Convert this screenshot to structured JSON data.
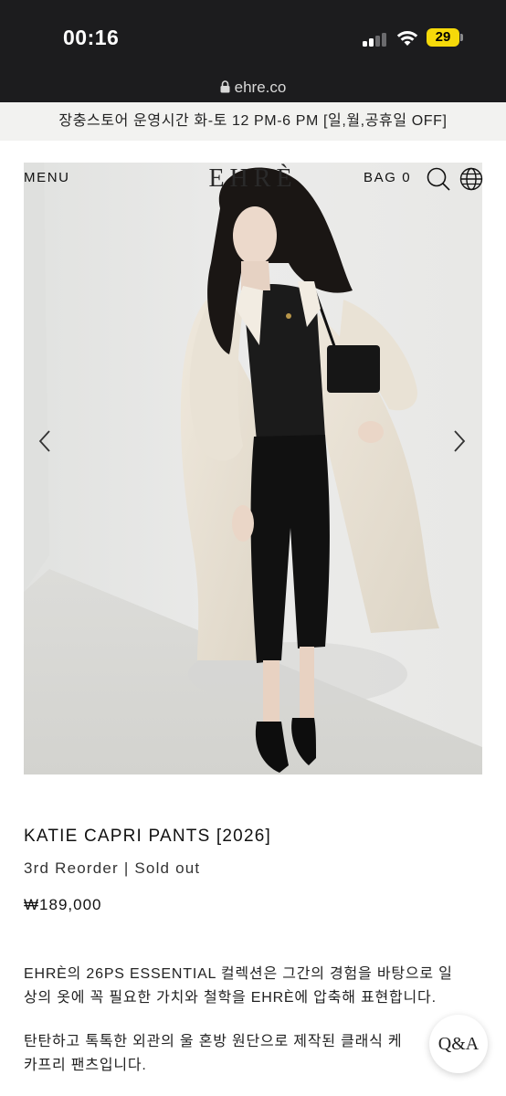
{
  "status_bar": {
    "time": "00:16",
    "battery_level": "29",
    "signal_icon": "cellular-signal-icon",
    "wifi_icon": "wifi-icon"
  },
  "browser": {
    "url": "ehre.co",
    "lock_icon": "lock-icon"
  },
  "notice": {
    "text": "장충스토어 운영시간 화-토 12 PM-6 PM [일,월,공휴일 OFF]"
  },
  "header": {
    "menu_label": "MENU",
    "logo": "EHRÈ",
    "bag_label": "BAG 0",
    "search_icon": "search-icon",
    "language_icon": "globe-icon"
  },
  "carousel": {
    "prev_icon": "chevron-left-icon",
    "next_icon": "chevron-right-icon"
  },
  "product": {
    "name": "KATIE CAPRI PANTS [2026]",
    "status": "3rd Reorder | Sold out",
    "price": "₩189,000",
    "description_1_line_1": "EHRÈ의 26PS ESSENTIAL 컬렉션은 그간의 경험을 바탕으로 일",
    "description_1_line_2": "상의 옷에 꼭 필요한 가치와 철학을 EHRÈ에 압축해 표현합니다.",
    "description_2_line_1": "탄탄하고 톡톡한 외관의 울 혼방 원단으로 제작된 클래식 케",
    "description_2_line_2": "카프리 팬츠입니다."
  },
  "qa_button": {
    "label": "Q&A"
  },
  "colors": {
    "status_bar_bg": "#1c1c1e",
    "notice_bg": "#f2f2f0",
    "battery": "#f5d90a"
  }
}
